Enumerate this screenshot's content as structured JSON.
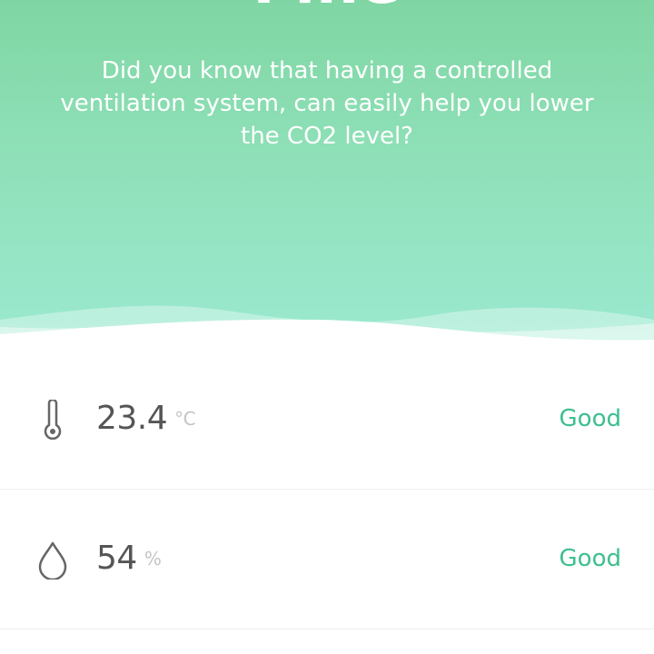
{
  "hero": {
    "title": "Fine",
    "tip": "Did you know that having a controlled ventilation system, can easily help you lower the CO2 level?"
  },
  "readings": [
    {
      "icon": "thermometer-icon",
      "value": "23.4",
      "unit": "°C",
      "status": "Good"
    },
    {
      "icon": "water-drop-icon",
      "value": "54",
      "unit": "%",
      "status": "Good"
    }
  ],
  "colors": {
    "gradient_top": "#7fd6a3",
    "gradient_bottom": "#9be9d0",
    "status_good": "#3dbf8f",
    "value_text": "#555555",
    "unit_text": "#c4c4c4"
  }
}
